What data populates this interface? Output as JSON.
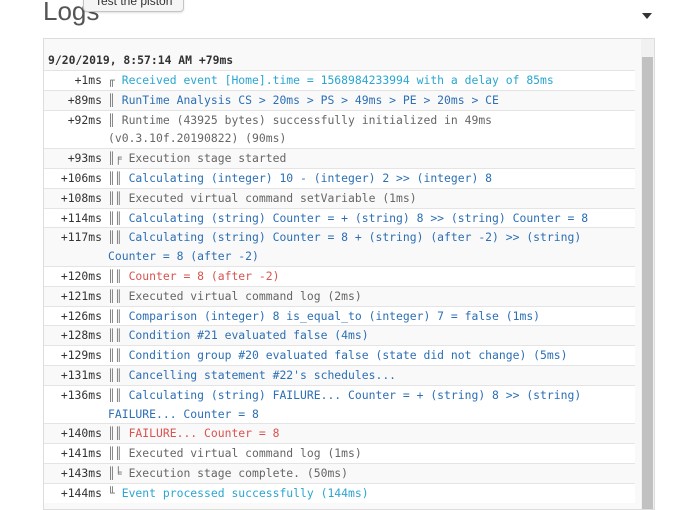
{
  "header": {
    "title": "Logs",
    "test_button_label": "Test the piston"
  },
  "log": {
    "header_line": "9/20/2019, 8:57:14 AM +79ms",
    "entries": [
      {
        "ts": "+1ms",
        "prefix": "╓",
        "text": "Received event [Home].time = 1568984233994 with a delay of 85ms",
        "color": "info"
      },
      {
        "ts": "+89ms",
        "prefix": "║",
        "text": "RunTime Analysis CS > 20ms > PS > 49ms > PE > 20ms > CE",
        "color": "blue"
      },
      {
        "ts": "+92ms",
        "prefix": "║",
        "text": "Runtime (43925 bytes) successfully initialized in 49ms (v0.3.10f.20190822) (90ms)",
        "color": "gray"
      },
      {
        "ts": "+93ms",
        "prefix": "║╒",
        "text": "Execution stage started",
        "color": "gray"
      },
      {
        "ts": "+106ms",
        "prefix": "║║",
        "text": "Calculating (integer) 10 - (integer) 2 >> (integer) 8",
        "color": "blue"
      },
      {
        "ts": "+108ms",
        "prefix": "║║",
        "text": "Executed virtual command setVariable (1ms)",
        "color": "gray"
      },
      {
        "ts": "+114ms",
        "prefix": "║║",
        "text": "Calculating (string) Counter = + (string) 8 >> (string) Counter = 8",
        "color": "blue"
      },
      {
        "ts": "+117ms",
        "prefix": "║║",
        "text": "Calculating (string) Counter = 8 + (string) (after -2) >> (string) Counter = 8 (after -2)",
        "color": "blue"
      },
      {
        "ts": "+120ms",
        "prefix": "║║",
        "text": "Counter = 8 (after -2)",
        "color": "red"
      },
      {
        "ts": "+121ms",
        "prefix": "║║",
        "text": "Executed virtual command log (2ms)",
        "color": "gray"
      },
      {
        "ts": "+126ms",
        "prefix": "║║",
        "text": "Comparison (integer) 8 is_equal_to (integer) 7 = false (1ms)",
        "color": "blue"
      },
      {
        "ts": "+128ms",
        "prefix": "║║",
        "text": "Condition #21 evaluated false (4ms)",
        "color": "blue"
      },
      {
        "ts": "+129ms",
        "prefix": "║║",
        "text": "Condition group #20 evaluated false (state did not change) (5ms)",
        "color": "blue"
      },
      {
        "ts": "+131ms",
        "prefix": "║║",
        "text": "Cancelling statement #22's schedules...",
        "color": "blue"
      },
      {
        "ts": "+136ms",
        "prefix": "║║",
        "text": "Calculating (string) FAILURE... Counter = + (string) 8 >> (string) FAILURE... Counter = 8",
        "color": "blue"
      },
      {
        "ts": "+140ms",
        "prefix": "║║",
        "text": "FAILURE... Counter = 8",
        "color": "red"
      },
      {
        "ts": "+141ms",
        "prefix": "║║",
        "text": "Executed virtual command log (1ms)",
        "color": "gray"
      },
      {
        "ts": "+143ms",
        "prefix": "║╘",
        "text": "Execution stage complete. (50ms)",
        "color": "gray"
      },
      {
        "ts": "+144ms",
        "prefix": "╙",
        "text": "Event processed successfully (144ms)",
        "color": "info"
      }
    ]
  },
  "colors": {
    "info": "#2aa6d1",
    "blue": "#2c6fb5",
    "gray": "#666666",
    "red": "#d9534f"
  },
  "icons": {
    "collapse": "caret-down-icon"
  }
}
